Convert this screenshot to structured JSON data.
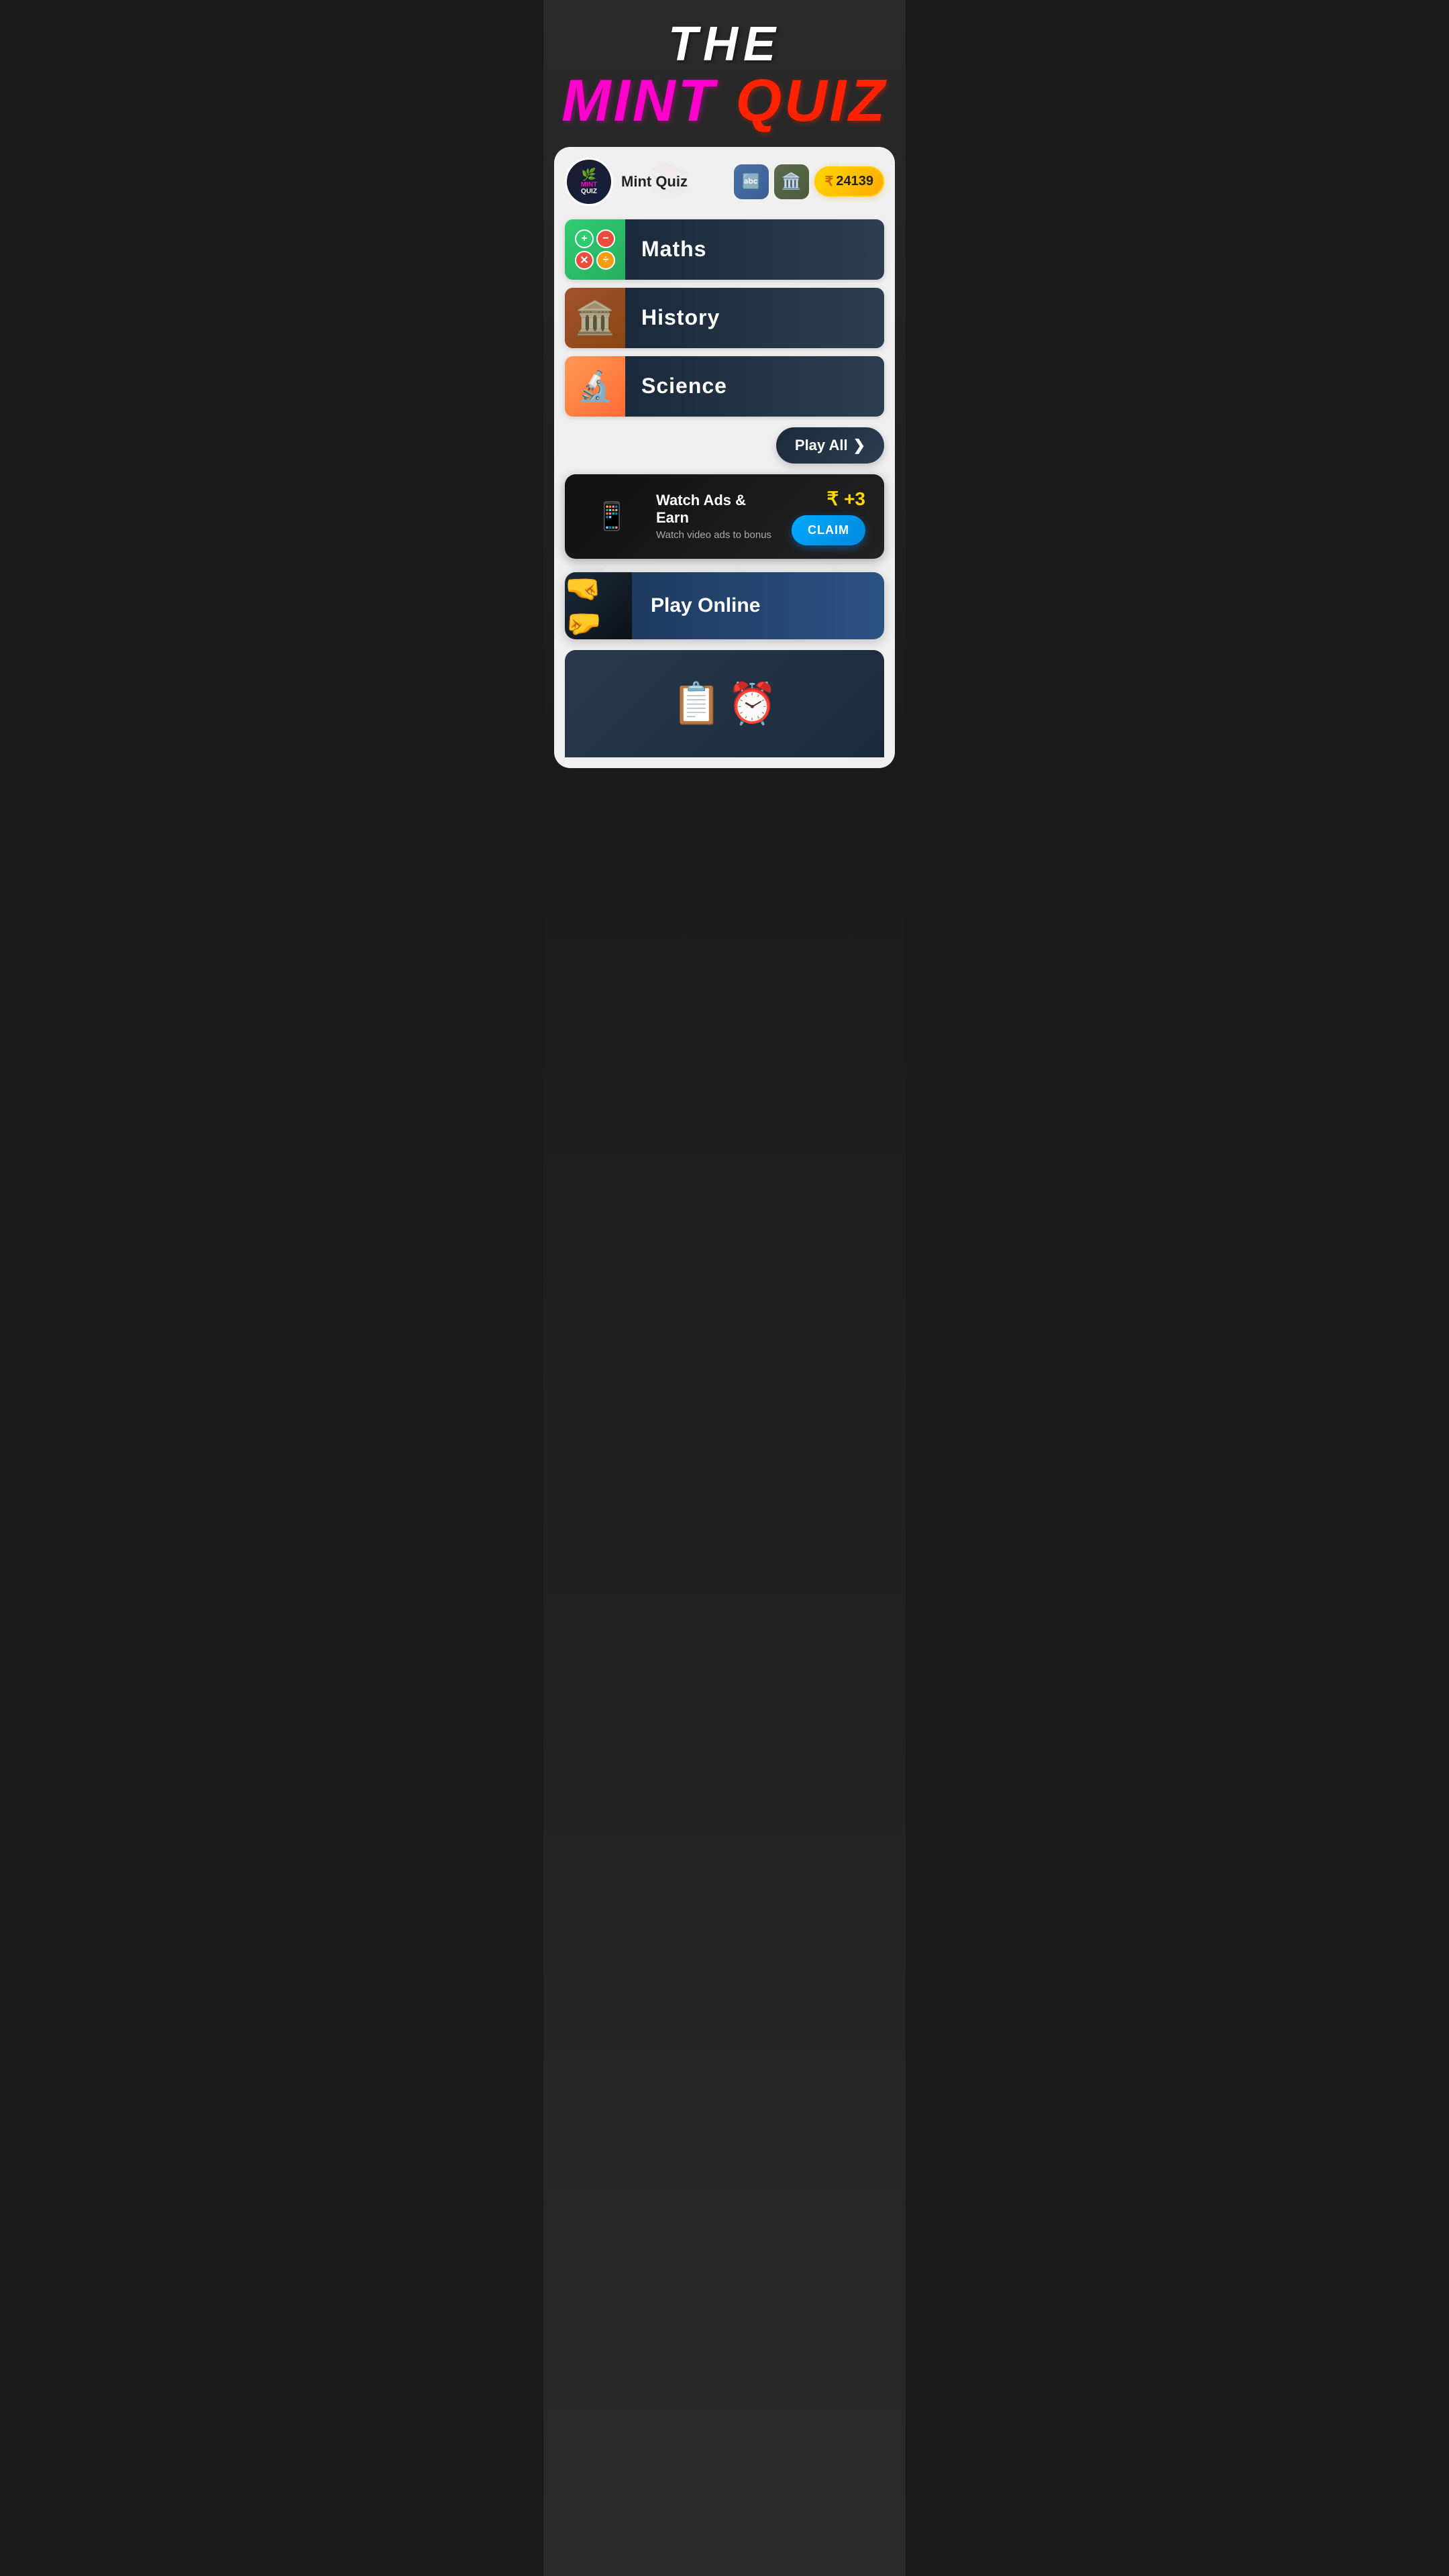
{
  "app": {
    "title": "THE",
    "subtitle_mint": "MINT ",
    "subtitle_quiz": "QUIZ",
    "name": "Mint Quiz",
    "coins": "24139",
    "rupee": "₹"
  },
  "header": {
    "translate_icon": "🔤",
    "shop_icon": "🏛️",
    "coins_label": "24139"
  },
  "categories": [
    {
      "id": "maths",
      "label": "Maths",
      "thumb_type": "maths"
    },
    {
      "id": "history",
      "label": "History",
      "thumb_type": "history"
    },
    {
      "id": "science",
      "label": "Science",
      "thumb_type": "science"
    }
  ],
  "play_all": {
    "label": "Play All",
    "arrow": "❯"
  },
  "ads_banner": {
    "title": "Watch Ads & Earn",
    "subtitle": "Watch video ads to bonus",
    "reward": "+3",
    "claim_label": "CLAIM"
  },
  "play_online": {
    "label": "Play Online"
  },
  "bottom_card": {
    "visible": true
  },
  "math_icons": [
    {
      "symbol": "+",
      "class": "plus"
    },
    {
      "symbol": "−",
      "class": "minus"
    },
    {
      "symbol": "✕",
      "class": "x"
    },
    {
      "symbol": "÷",
      "class": "div"
    }
  ]
}
